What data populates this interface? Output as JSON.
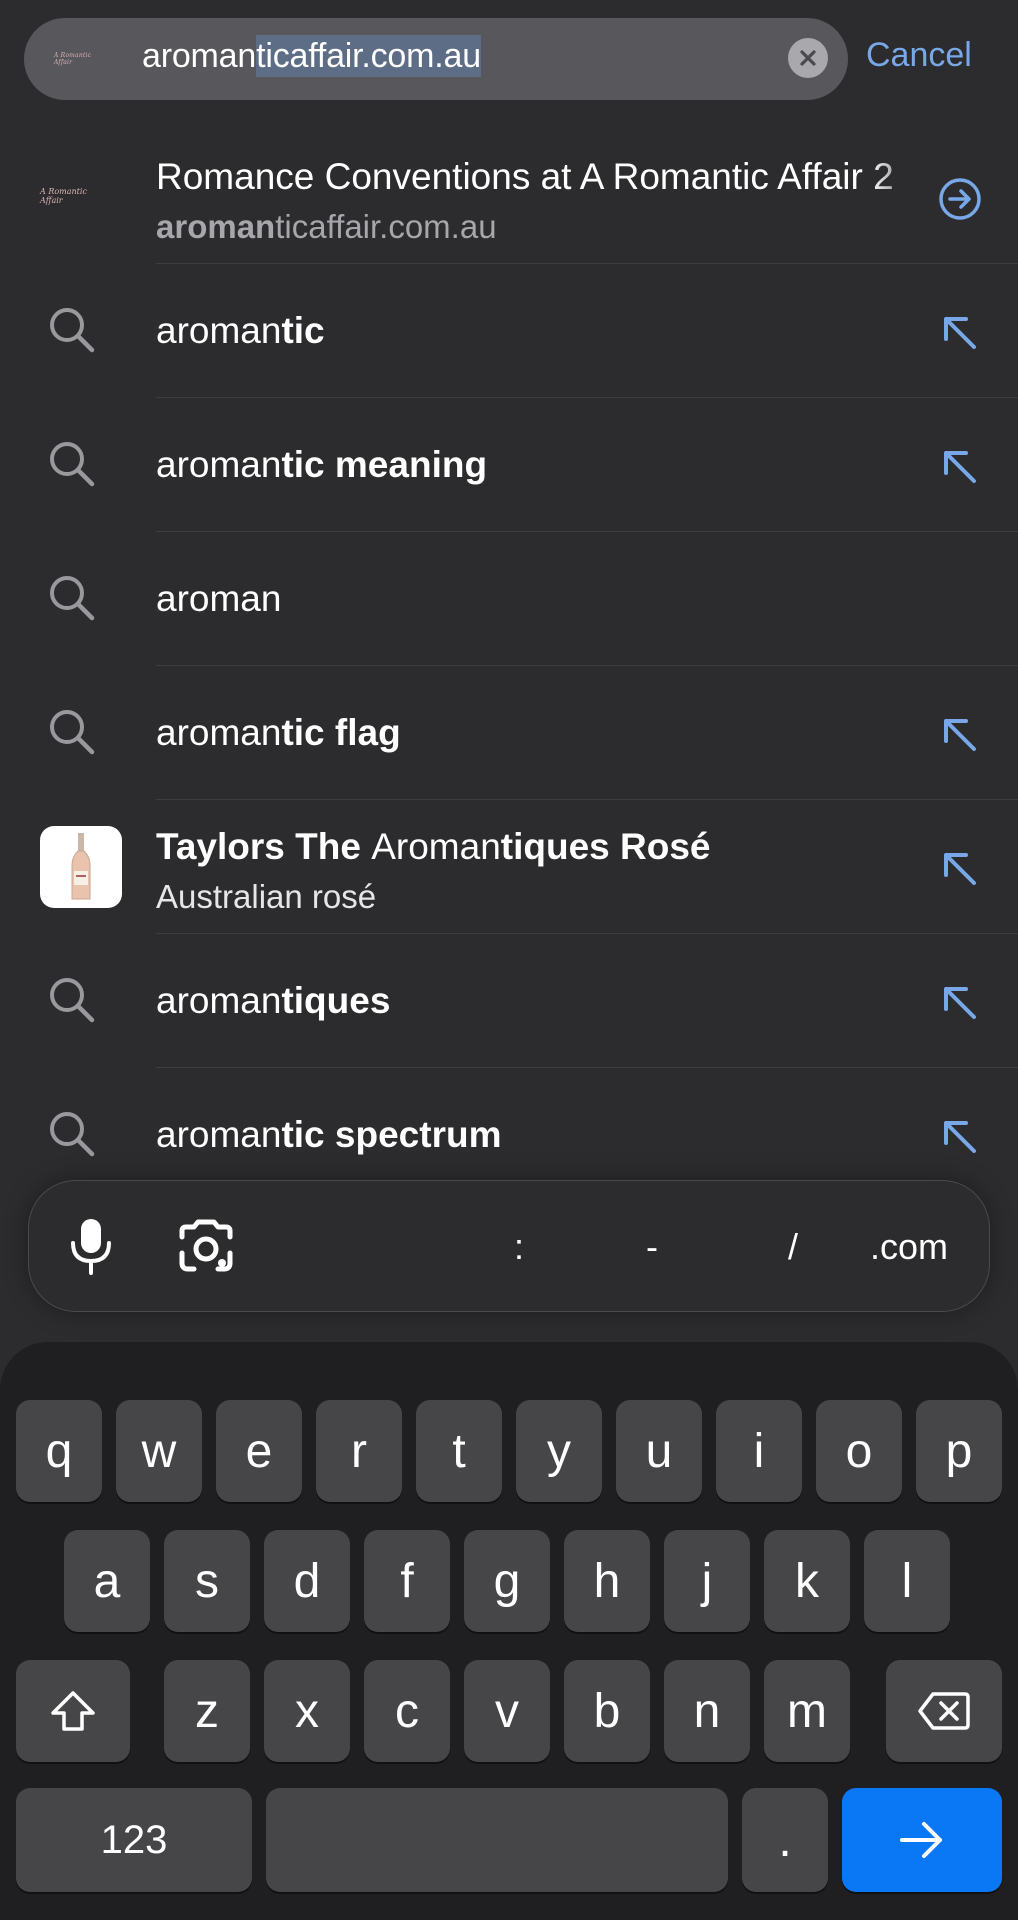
{
  "address_bar": {
    "favicon_text": "A Romantic Affair",
    "url_typed": "aroman",
    "url_selected": "ticaffair.com.au",
    "cancel_label": "Cancel"
  },
  "suggestions": [
    {
      "icon": "site-favicon",
      "title_plain": "Romance Conventions at A Romantic Affair 2",
      "subtitle_bold": "aroman",
      "subtitle_plain": "ticaffair.com.au",
      "trail_icon": "go-arrow-circle-icon"
    },
    {
      "icon": "search-icon",
      "plain": "aroman",
      "bold": "tic",
      "trail_icon": "fill-arrow-icon"
    },
    {
      "icon": "search-icon",
      "plain": "aroman",
      "bold": "tic meaning",
      "trail_icon": "fill-arrow-icon"
    },
    {
      "icon": "search-icon",
      "plain": "aroman",
      "bold": "",
      "trail_icon": ""
    },
    {
      "icon": "search-icon",
      "plain": "aroman",
      "bold": "tic flag",
      "trail_icon": "fill-arrow-icon"
    },
    {
      "icon": "wine-bottle-thumbnail",
      "title_bold1": "Taylors The ",
      "title_plain": "Aroman",
      "title_bold2": "tiques Rosé",
      "subtitle": "Australian rosé",
      "trail_icon": "fill-arrow-icon"
    },
    {
      "icon": "search-icon",
      "plain": "aroman",
      "bold": "tiques",
      "trail_icon": "fill-arrow-icon"
    },
    {
      "icon": "search-icon",
      "plain": "aroman",
      "bold": "tic spectrum",
      "trail_icon": "fill-arrow-icon"
    }
  ],
  "shortcuts": {
    "colon": ":",
    "dash": "-",
    "slash": "/",
    "dotcom": ".com"
  },
  "keyboard": {
    "row1": [
      "q",
      "w",
      "e",
      "r",
      "t",
      "y",
      "u",
      "i",
      "o",
      "p"
    ],
    "row2": [
      "a",
      "s",
      "d",
      "f",
      "g",
      "h",
      "j",
      "k",
      "l"
    ],
    "row3": [
      "z",
      "x",
      "c",
      "v",
      "b",
      "n",
      "m"
    ],
    "numbers_label": "123",
    "period_label": "."
  },
  "colors": {
    "accent": "#78a8e8",
    "go_key": "#0a78f5",
    "background": "#2c2c2e"
  }
}
